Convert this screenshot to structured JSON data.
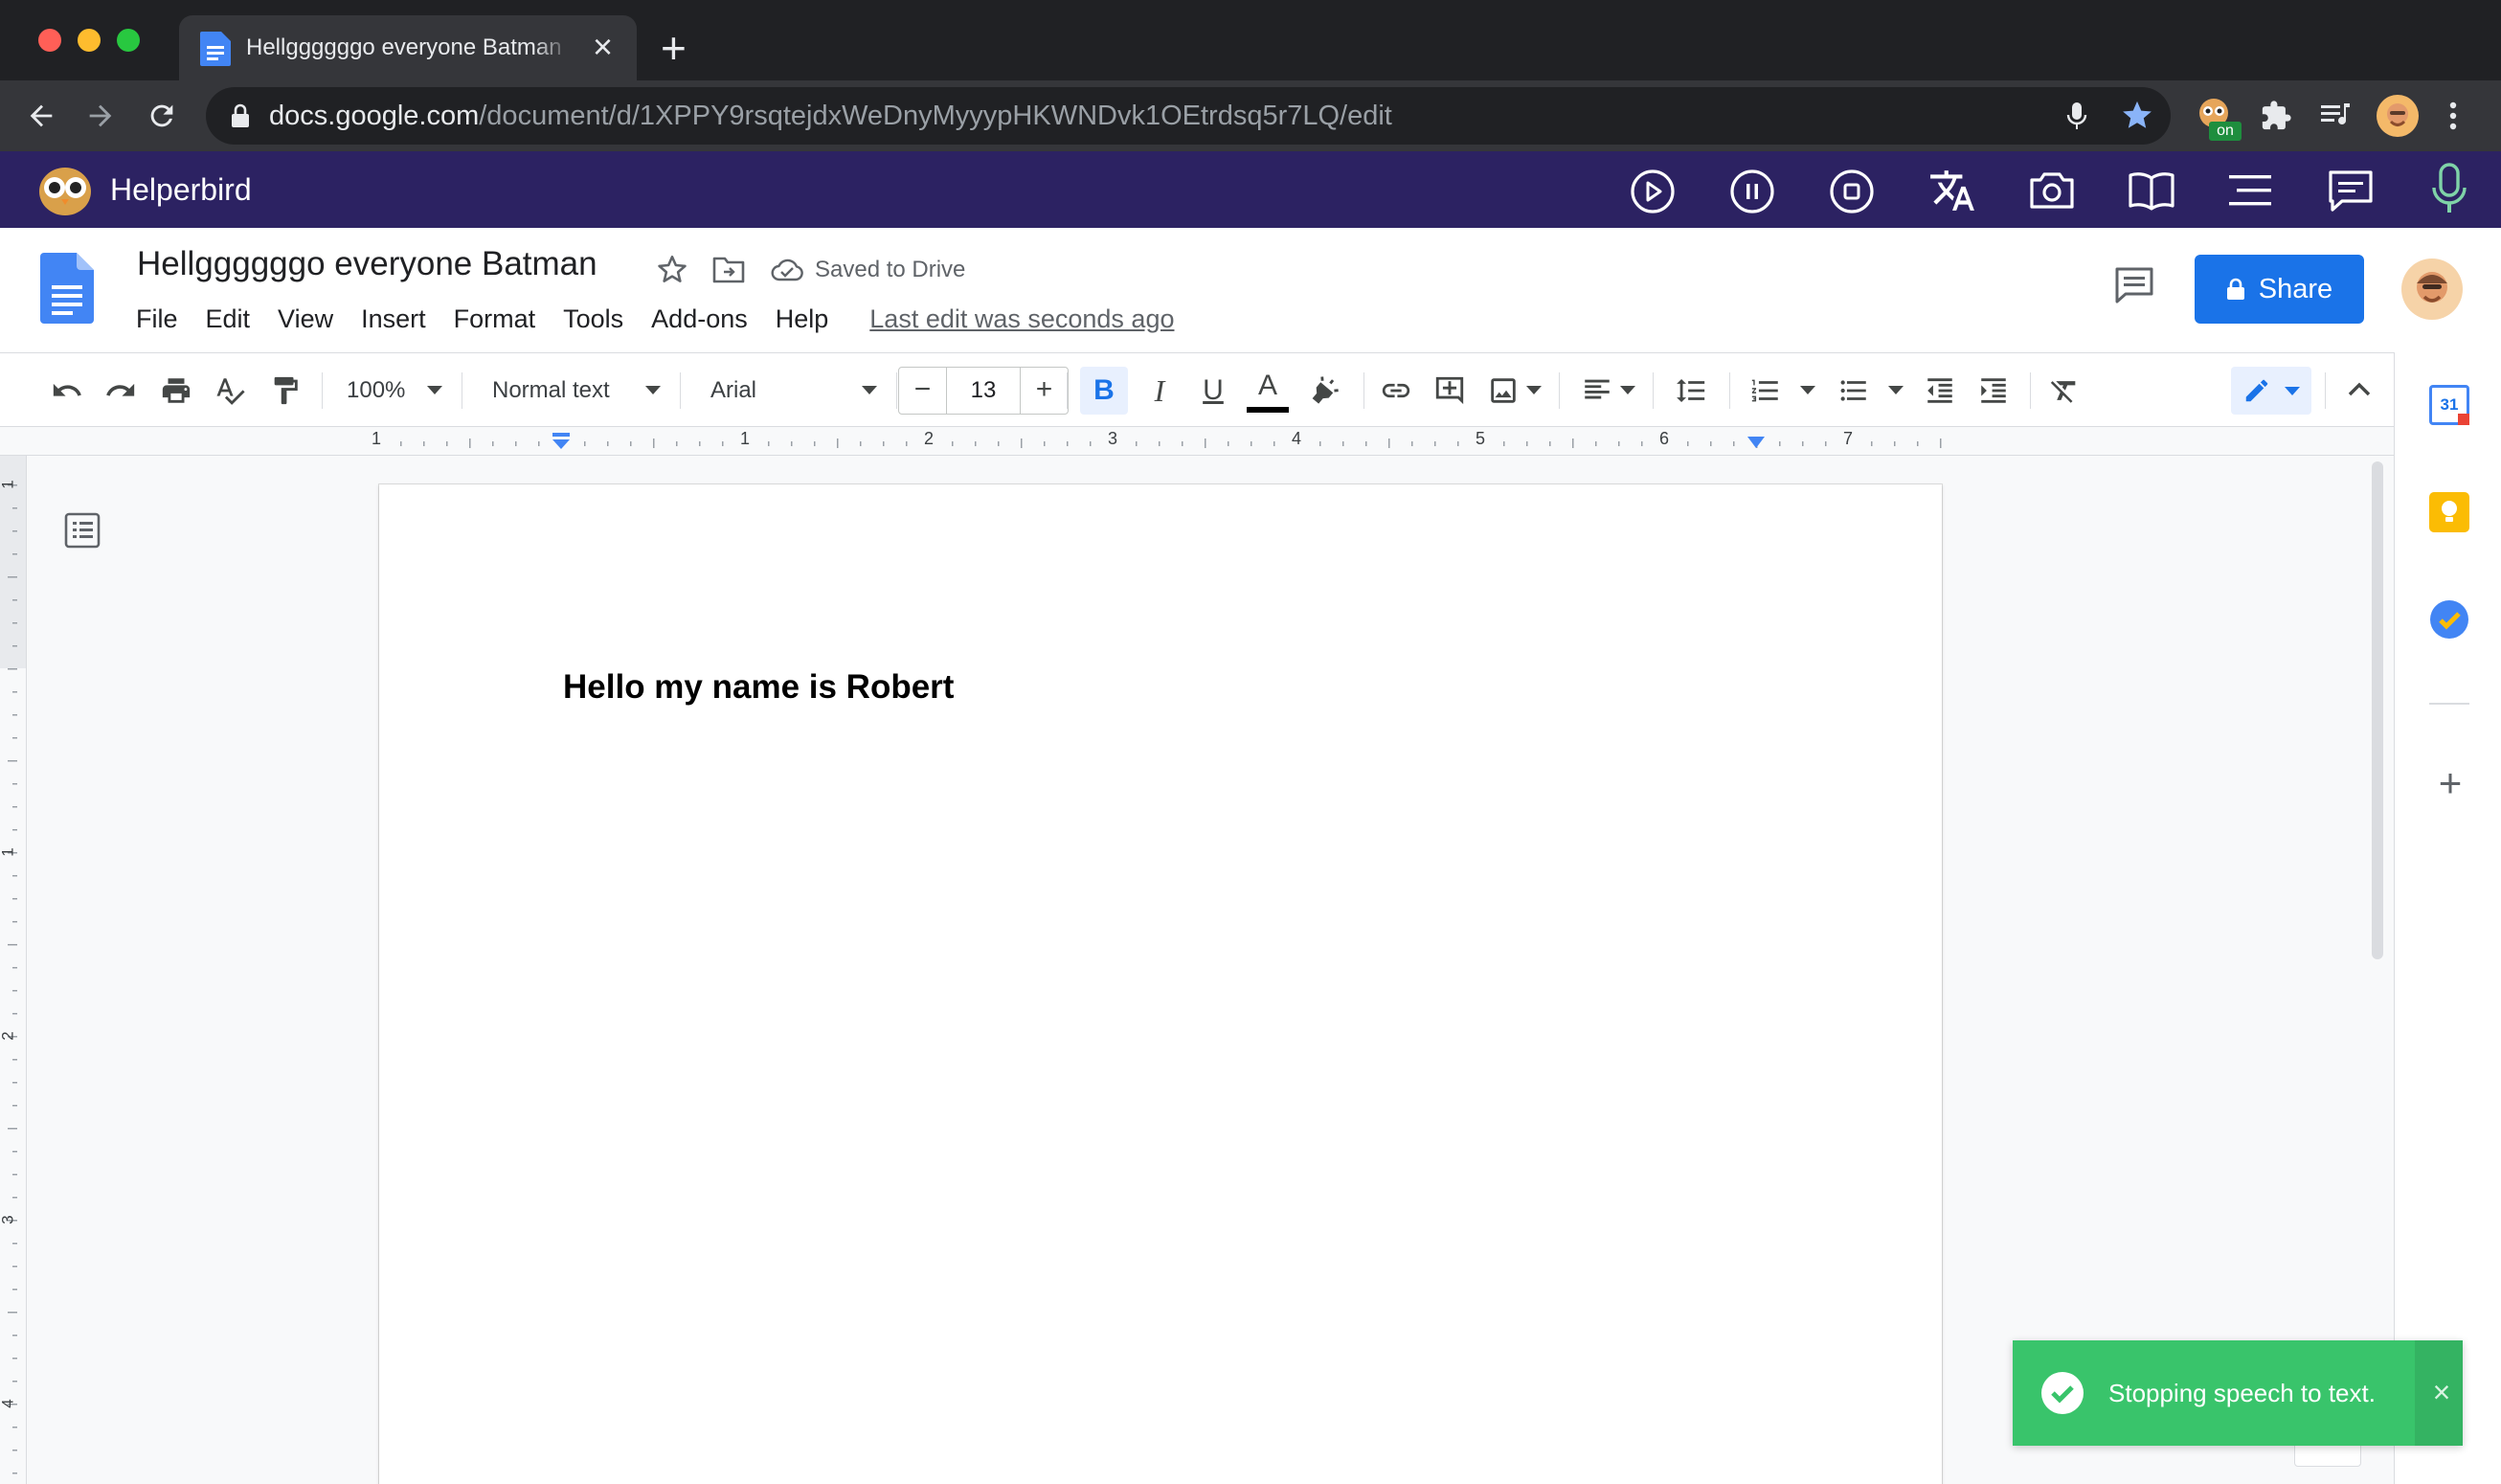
{
  "browser": {
    "tab": {
      "title": "Hellggggggo everyone Batman",
      "close_glyph": "×"
    },
    "new_tab_glyph": "+",
    "address": {
      "host": "docs.google.com",
      "path": "/document/d/1XPPY9rsqtejdxWeDnyMyyypHKWNDvk1OEtrdsq5r7LQ/edit"
    },
    "extension_badge": "on"
  },
  "helperbird": {
    "name": "Helperbird"
  },
  "docs": {
    "title": "Hellggggggo everyone Batman",
    "save_status": "Saved to Drive",
    "menus": [
      "File",
      "Edit",
      "View",
      "Insert",
      "Format",
      "Tools",
      "Add-ons",
      "Help"
    ],
    "last_edit": "Last edit was seconds ago",
    "share_label": "Share",
    "toolbar": {
      "zoom": "100%",
      "style": "Normal text",
      "font": "Arial",
      "font_size": "13",
      "minus": "−",
      "plus": "+",
      "bold": "B",
      "italic": "I",
      "underline": "U",
      "text_color": "A"
    },
    "ruler_numbers": [
      "1",
      "1",
      "2",
      "3",
      "4",
      "5",
      "6",
      "7"
    ],
    "vruler_numbers": [
      "1",
      "1",
      "2",
      "3",
      "4"
    ],
    "body_text": "Hello my name is Robert"
  },
  "side_panel": {
    "calendar_day": "31",
    "add_glyph": "+"
  },
  "toast": {
    "message": "Stopping speech to text.",
    "close_glyph": "×"
  },
  "colors": {
    "chrome_dark": "#202124",
    "chrome_toolbar": "#35363a",
    "helperbird_bar": "#2c2262",
    "docs_blue": "#1a73e8",
    "toast_green": "#39c46b"
  }
}
